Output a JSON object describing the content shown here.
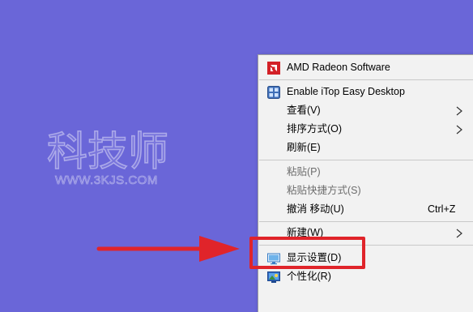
{
  "watermark": {
    "logo_text": "科技师",
    "url_text": "WWW.3KJS.COM"
  },
  "context_menu": {
    "items": [
      {
        "label": "AMD Radeon Software",
        "icon": "amd-radeon-icon"
      },
      {
        "label": "Enable iTop Easy Desktop",
        "icon": "itop-easy-desktop-icon"
      },
      {
        "label": "查看(V)",
        "submenu": true
      },
      {
        "label": "排序方式(O)",
        "submenu": true
      },
      {
        "label": "刷新(E)"
      },
      {
        "label": "粘贴(P)",
        "disabled": true
      },
      {
        "label": "粘贴快捷方式(S)",
        "disabled": true
      },
      {
        "label": "撤消 移动(U)",
        "shortcut": "Ctrl+Z"
      },
      {
        "label": "新建(W)",
        "submenu": true
      },
      {
        "label": "显示设置(D)",
        "icon": "display-settings-icon",
        "highlighted": true
      },
      {
        "label": "个性化(R)",
        "icon": "personalize-icon"
      }
    ]
  },
  "colors": {
    "desktop_background": "#6a66d8",
    "menu_background": "#f2f2f2",
    "annotation_red": "#e0242a",
    "amd_red": "#d32027"
  }
}
